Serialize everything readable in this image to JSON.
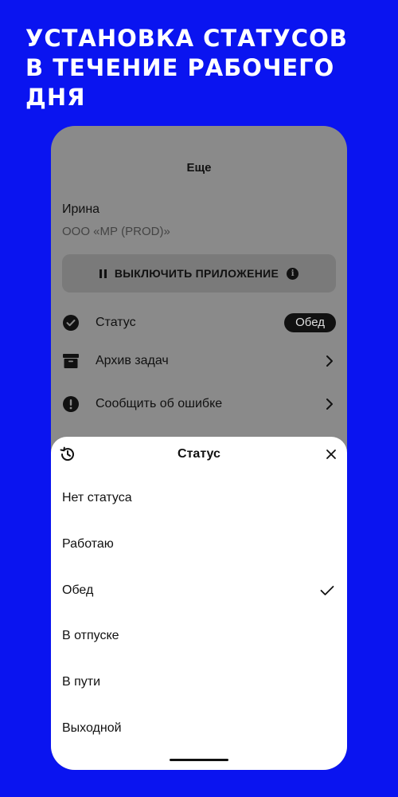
{
  "headline": {
    "lines": [
      "УСТАНОВКА СТАТУСОВ",
      "В ТЕЧЕНИЕ РАБОЧЕГО",
      "ДНЯ"
    ]
  },
  "more_screen": {
    "title": "Еще",
    "user_name": "Ирина",
    "company": "ООО «МР (PROD)»",
    "disable_button_label": "ВЫКЛЮЧИТЬ ПРИЛОЖЕНИЕ",
    "info_icon": "info-icon",
    "menu": [
      {
        "label": "Статус",
        "icon": "check-circle-icon",
        "badge": "Обед"
      },
      {
        "label": "Архив задач",
        "icon": "archive-icon"
      },
      {
        "label": "Сообщить об ошибке",
        "icon": "exclamation-circle-icon"
      }
    ]
  },
  "status_sheet": {
    "title": "Статус",
    "history_icon": "history-icon",
    "close_icon": "close-icon",
    "selected_index": 2,
    "options": [
      {
        "label": "Нет статуса"
      },
      {
        "label": "Работаю"
      },
      {
        "label": "Обед"
      },
      {
        "label": "В отпуске"
      },
      {
        "label": "В пути"
      },
      {
        "label": "Выходной"
      }
    ]
  },
  "colors": {
    "background": "#0a14f0",
    "overlay": "#8a8a8a",
    "sheet": "#ffffff",
    "text": "#111111"
  }
}
